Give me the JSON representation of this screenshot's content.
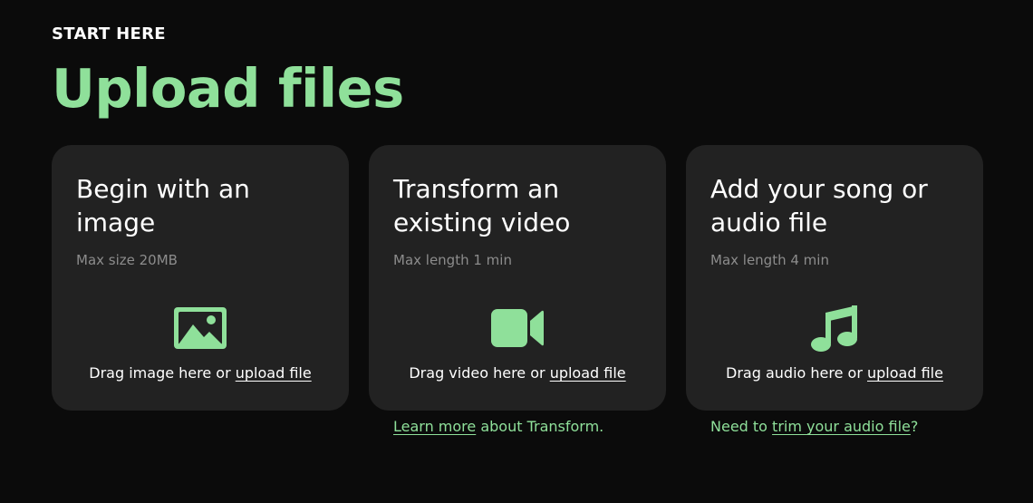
{
  "header": {
    "eyebrow": "START HERE",
    "title": "Upload files"
  },
  "colors": {
    "accent": "#8fe09a",
    "card_bg": "#222222",
    "page_bg": "#0b0b0b"
  },
  "cards": [
    {
      "title": "Begin with an image",
      "subtitle": "Max size 20MB",
      "icon": "image-icon",
      "drop_text": "Drag image here or ",
      "upload_link": "upload file",
      "footer_link": "",
      "footer_text": "",
      "footer_prefix": ""
    },
    {
      "title": "Transform an existing video",
      "subtitle": "Max length 1 min",
      "icon": "video-camera-icon",
      "drop_text": "Drag video here or ",
      "upload_link": "upload file",
      "footer_prefix": "",
      "footer_link": "Learn more",
      "footer_text": " about Transform."
    },
    {
      "title": "Add your song or audio file",
      "subtitle": "Max length 4 min",
      "icon": "music-note-icon",
      "drop_text": "Drag audio here or ",
      "upload_link": "upload file",
      "footer_prefix": "Need to ",
      "footer_link": "trim your audio file",
      "footer_text": "?"
    }
  ]
}
